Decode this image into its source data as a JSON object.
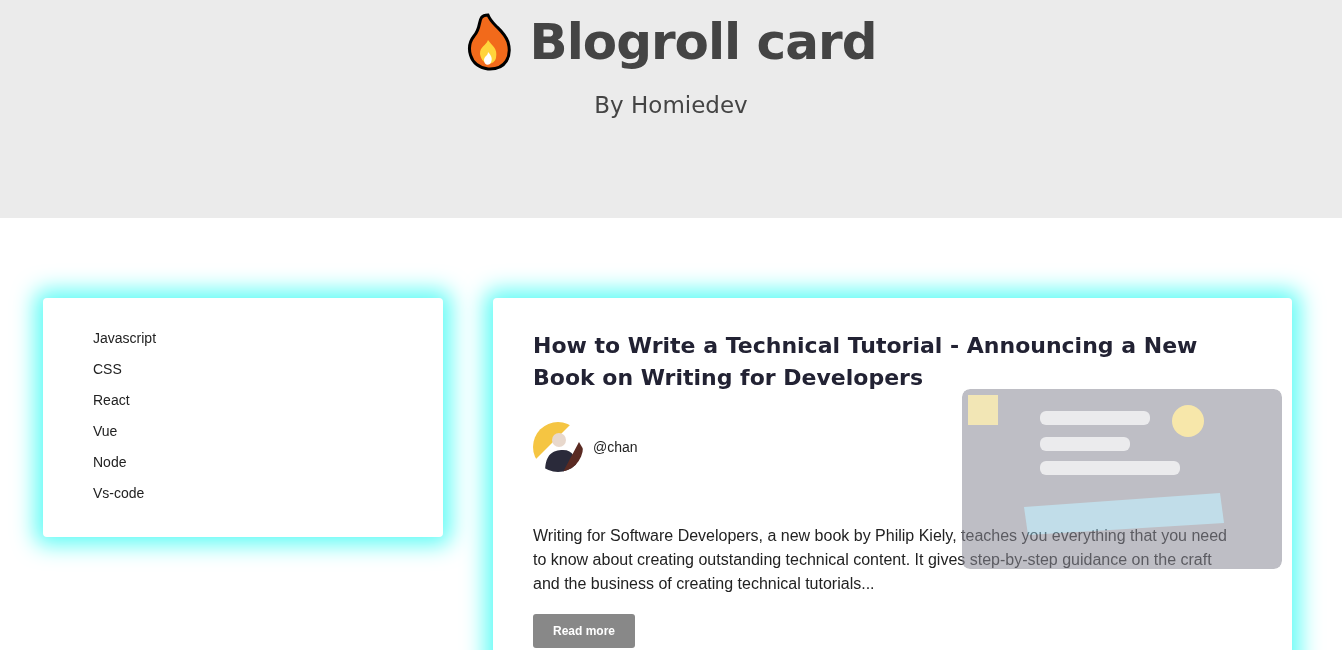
{
  "header": {
    "title": "Blogroll card",
    "subtitle": "By Homiedev"
  },
  "categories": [
    {
      "label": "Javascript"
    },
    {
      "label": "CSS"
    },
    {
      "label": "React"
    },
    {
      "label": "Vue"
    },
    {
      "label": "Node"
    },
    {
      "label": "Vs-code"
    }
  ],
  "post": {
    "title": "How to Write a Technical Tutorial - Announcing a New Book on Writing for Developers",
    "author": "@chan",
    "excerpt": "Writing for Software Developers, a new book by Philip Kiely, teaches you everything that you need to know about creating outstanding technical content. It gives step-by-step guidance on the craft and the business of creating technical tutorials...",
    "button": "Read more"
  }
}
